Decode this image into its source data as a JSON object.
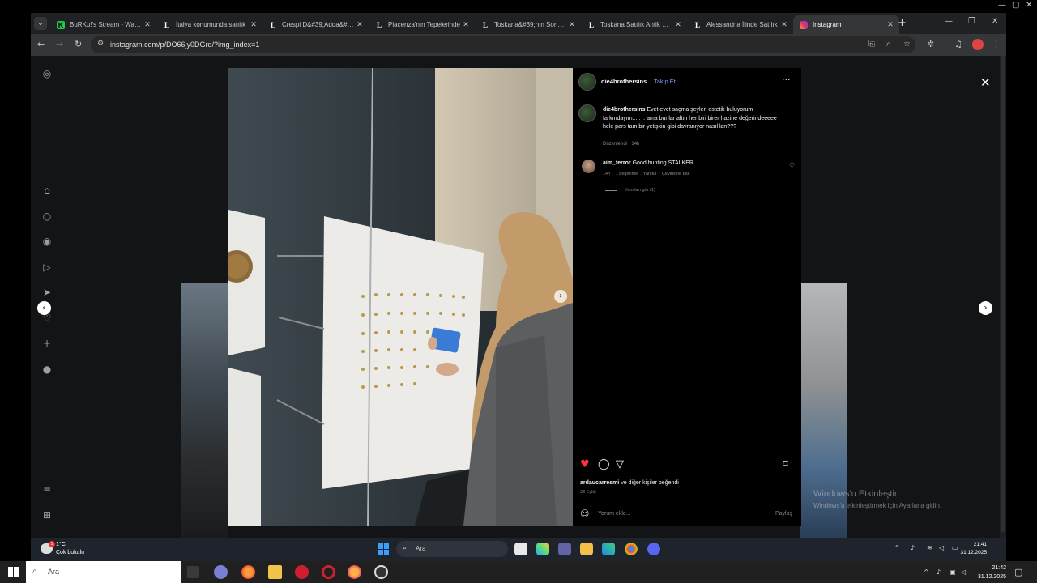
{
  "os": {
    "window_controls": {
      "minimize": "—",
      "maximize": "▢",
      "close": "✕"
    }
  },
  "browser": {
    "tabs": [
      {
        "label": "BuRKu!'s Stream - Watch",
        "favicon": "kick-icon",
        "active": false
      },
      {
        "label": "İtalya konumunda satılık",
        "favicon": "l-icon",
        "active": false
      },
      {
        "label": "Crespi D&#39;Adda&#39;",
        "favicon": "l-icon",
        "active": false
      },
      {
        "label": "Piacenza'nın Tepelerinde",
        "favicon": "l-icon",
        "active": false
      },
      {
        "label": "Toskana&#39;nın Sonsuz",
        "favicon": "l-icon",
        "active": false
      },
      {
        "label": "Toskana Satılık Antik Kale",
        "favicon": "l-icon",
        "active": false
      },
      {
        "label": "Alessandria İlinde Satılık",
        "favicon": "l-icon",
        "active": false
      },
      {
        "label": "Instagram",
        "favicon": "instagram-icon",
        "active": true
      }
    ],
    "url": "instagram.com/p/DO66jy0DGrd/?img_index=1"
  },
  "post": {
    "username": "die4brothersins",
    "follow_label": "Takip Et",
    "caption_user": "die4brothersins",
    "caption_text": "Evet evet saçma şeyleri estetik buluyorum farkındayım... ._. ama bunlar altın her biri birer hazine değerindeeeee hele pars tam bir yetişkin gibi davranıyor nasıl lan???",
    "caption_meta": "Düzenlendi · 14h",
    "comment": {
      "user": "aim_terror",
      "text": "Good hunting STALKER...",
      "time": "14h",
      "likes": "1 beğenme",
      "reply": "Yanıtla",
      "translate": "Çevirisine bak"
    },
    "view_replies": "Yanıtları gör (1)",
    "liked_by": "ardaucarresmi",
    "liked_by_suffix": "ve diğer kişiler beğendi",
    "date": "23 Eylül",
    "comment_placeholder": "Yorum ekle...",
    "share_label": "Paylaş"
  },
  "watermark": {
    "title": "Windows'u Etkinleştir",
    "subtitle": "Windows'u etkinleştirmek için Ayarlar'a gidin."
  },
  "inner_taskbar": {
    "temperature": "1°C",
    "condition": "Çok bulutlu",
    "search_label": "Ara",
    "weather_badge": "1",
    "time": "21:41",
    "date": "31.12.2025"
  },
  "outer_taskbar": {
    "search_label": "Ara",
    "time": "21:42",
    "date": "31.12.2025"
  },
  "colors": {
    "like_red": "#ff3040",
    "follow_blue": "#8a9cff",
    "panel_bg": "#000000",
    "modal_bg": "#121416"
  }
}
